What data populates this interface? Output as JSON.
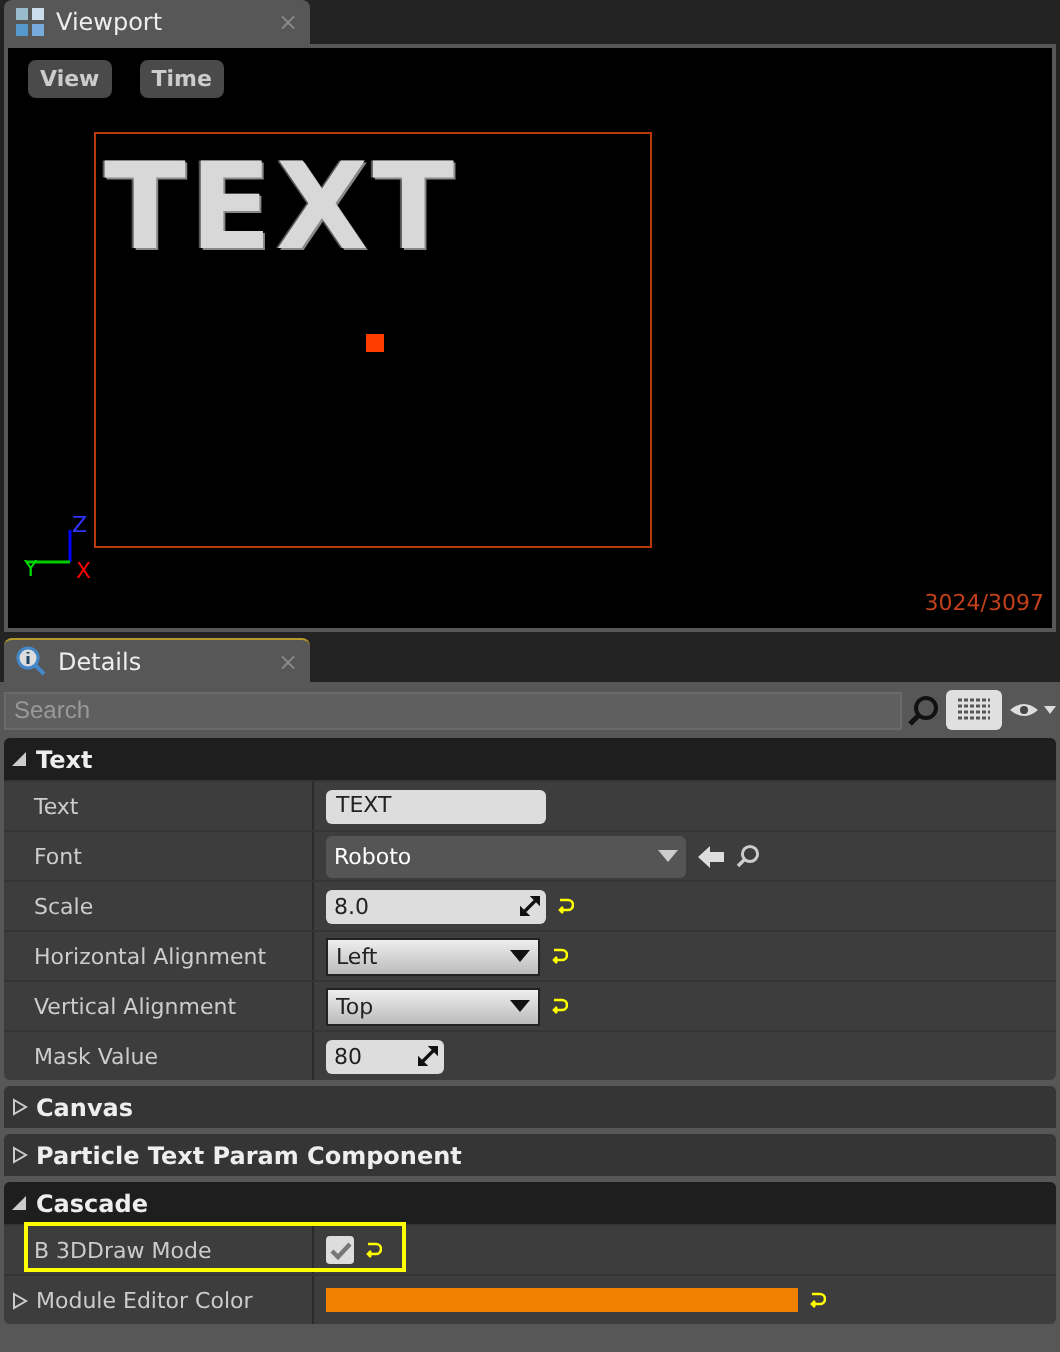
{
  "viewport": {
    "tab": "Viewport",
    "close": "×",
    "buttons": [
      "View",
      "Time"
    ],
    "scene_text": "TEXT",
    "axes": {
      "z": "Z",
      "y": "Y",
      "x": "X"
    },
    "counter": "3024/3097"
  },
  "details": {
    "tab": "Details",
    "close": "×",
    "search": {
      "placeholder": "Search"
    },
    "sections": [
      {
        "title": "Text",
        "expanded": true,
        "rows": [
          {
            "kind": "text",
            "label": "Text",
            "value": "TEXT"
          },
          {
            "kind": "asset",
            "label": "Font",
            "value": "Roboto"
          },
          {
            "kind": "number",
            "label": "Scale",
            "value": "8.0",
            "reset": true,
            "wide": true
          },
          {
            "kind": "dropdown",
            "label": "Horizontal Alignment",
            "value": "Left",
            "reset": true
          },
          {
            "kind": "dropdown",
            "label": "Vertical Alignment",
            "value": "Top",
            "reset": true
          },
          {
            "kind": "number",
            "label": "Mask Value",
            "value": "80",
            "reset": false,
            "wide": false
          }
        ]
      },
      {
        "title": "Canvas",
        "expanded": false
      },
      {
        "title": "Particle Text Param Component",
        "expanded": false
      },
      {
        "title": "Cascade",
        "expanded": true,
        "rows": [
          {
            "kind": "checkbox",
            "label": "B 3DDraw Mode",
            "checked": true,
            "reset": true,
            "highlighted": true
          },
          {
            "kind": "color",
            "label": "Module Editor Color",
            "color": "#f08000",
            "reset": true,
            "expandable": true
          }
        ]
      }
    ]
  }
}
